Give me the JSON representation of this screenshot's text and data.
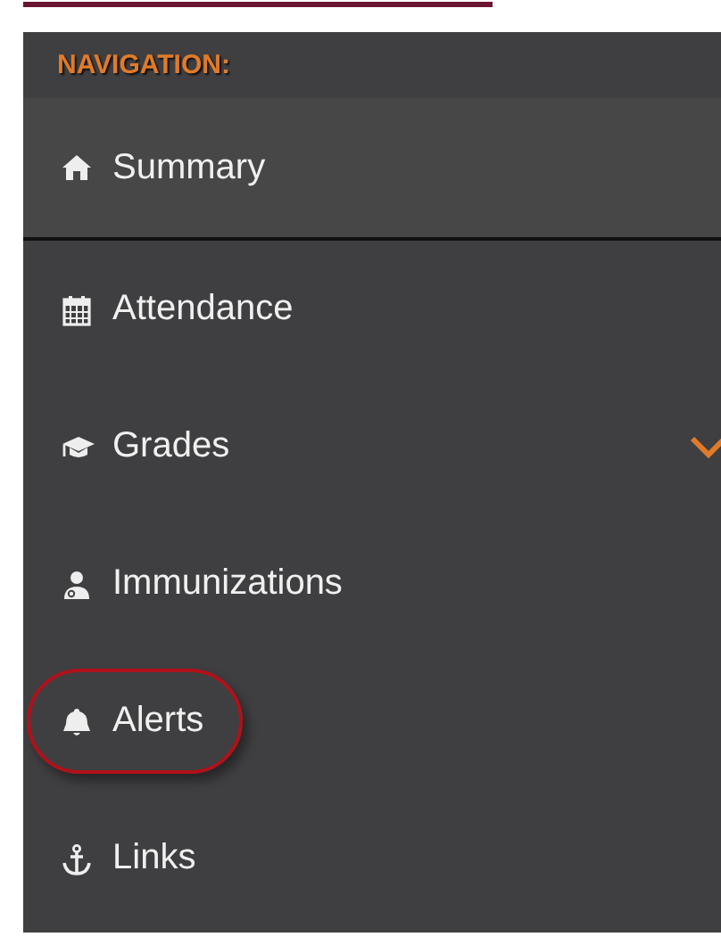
{
  "heading": "NAVIGATION:",
  "items": [
    {
      "label": "Summary",
      "kind": "link",
      "selected": true,
      "circled": false
    },
    {
      "label": "Attendance",
      "kind": "link",
      "selected": false,
      "circled": false
    },
    {
      "label": "Grades",
      "kind": "group",
      "selected": false,
      "circled": false
    },
    {
      "label": "Immunizations",
      "kind": "link",
      "selected": false,
      "circled": false
    },
    {
      "label": "Alerts",
      "kind": "link",
      "selected": false,
      "circled": true
    },
    {
      "label": "Links",
      "kind": "link",
      "selected": false,
      "circled": false
    }
  ]
}
